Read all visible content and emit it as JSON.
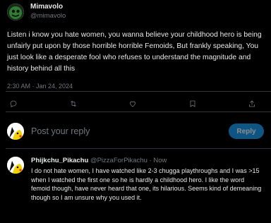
{
  "main_tweet": {
    "display_name": "Mimavolo",
    "handle": "@mimavolo",
    "text": "Listen i know you hate women, you wanna believe your childhood hero is being unfairly put upon by those horrible horrible Femoids, But frankly speaking, You just look like a desperate fool who refuses to understand the magnitude and history behind all this",
    "timestamp": "2:30 AM · Jan 24, 2024",
    "avatar_icon": "green-dark-avatar-icon"
  },
  "actions": {
    "icons": [
      "reply-icon",
      "retweet-icon",
      "like-icon",
      "bookmark-icon",
      "share-icon"
    ]
  },
  "reply_composer": {
    "placeholder": "Post your reply",
    "button_label": "Reply",
    "avatar_icon": "pikachu-avatar-icon"
  },
  "reply": {
    "display_name": "Phijkchu_Pikachu",
    "handle": "@PizzaForPikachu",
    "separator": "·",
    "time": "Now",
    "text": "I do not hate women, I have watched like 2-3 chugga playthroughs and I was >15 when I watched the first one so he is hardly a childhood hero. I like the word femoid though, have never heard that one, its hilarious. Seems kind of demeaning though so I am unsure why you used it.",
    "avatar_icon": "pikachu-avatar-icon"
  },
  "colors": {
    "background": "#000000",
    "text_primary": "#e7e9ea",
    "text_secondary": "#71767b",
    "accent": "#1d9bf0",
    "divider": "#2f3336"
  }
}
